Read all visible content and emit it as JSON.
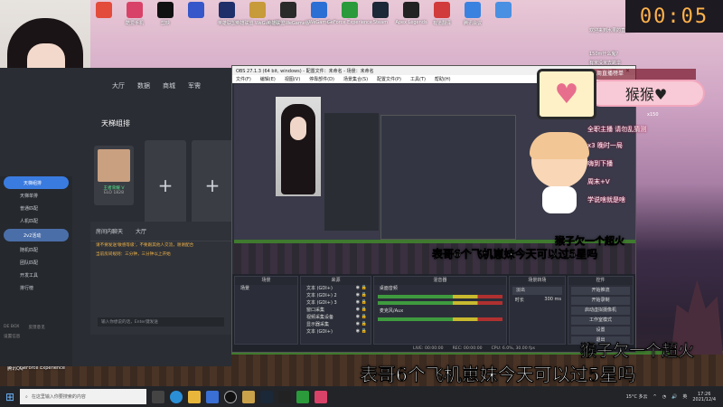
{
  "desktop_icons_top": [
    {
      "label": "",
      "color": "#e34b3b"
    },
    {
      "label": "酷爱手机",
      "color": "#d94268"
    },
    {
      "label": "剪映",
      "color": "#111111"
    },
    {
      "label": "",
      "color": "#3657c9"
    },
    {
      "label": "英雄联盟",
      "color": "#1e2f6a"
    },
    {
      "label": "英雄联盟 WeGame版",
      "color": "#c79a3a"
    },
    {
      "label": "英雄联盟WeGame版",
      "color": "#2a2a2a"
    },
    {
      "label": "WeGame",
      "color": "#2b6fd4"
    },
    {
      "label": "GeForce Experience",
      "color": "#2a9a3a"
    },
    {
      "label": "Steam",
      "color": "#1b2838"
    },
    {
      "label": "Apex Legends",
      "color": "#222222"
    },
    {
      "label": "有道翻译",
      "color": "#d13b3b"
    },
    {
      "label": "腾讯会议",
      "color": "#3a82e0"
    },
    {
      "label": "",
      "color": "#4a90e2"
    }
  ],
  "desktop_icons_bottom": [
    {
      "label": "腾讯QQ",
      "color": "#1a1a1a"
    },
    {
      "label": "GeForce Experience",
      "color": "#2a9a3a"
    }
  ],
  "timer": "00:05",
  "client": {
    "nav": [
      "大厅",
      "数据",
      "商城",
      "军需"
    ],
    "rank_title": "天梯组排",
    "rank_badge": "王者荣耀 V",
    "rank_sub": "ELO 1828",
    "sidebar": [
      "天梯组排",
      "天梯单排",
      "普通匹配",
      "人机匹配",
      "2v2活动",
      "随机匹配",
      "团队匹配",
      "开发工具",
      "排行榜"
    ],
    "sidebar_active_index": 0,
    "bottom_links": [
      "DE BOX",
      "反馈意见",
      "设置信息"
    ],
    "chat_tabs": [
      "房间内聊天",
      "大厅"
    ],
    "chat_lines": [
      "请不要发送'敏感等级'，不要跟其他人交流，谢谢配合",
      "当前房间规则：三分钟，三分钟以上开始"
    ],
    "chat_placeholder": "输入你想说的话，Enter键发送"
  },
  "obs": {
    "title": "OBS 27.1.3 (64 bit, windows) - 配置文件：未命名 - 场景：未命名",
    "menu": [
      "文件(F)",
      "编辑(E)",
      "视图(V)",
      "停靠部件(D)",
      "场景集合(S)",
      "配置文件(P)",
      "工具(T)",
      "帮助(H)"
    ],
    "dock_titles": [
      "场景",
      "来源",
      "混音器",
      "场景转场",
      "控件"
    ],
    "scenes": [
      "场景"
    ],
    "sources": [
      "文本 (GDI+)",
      "文本 (GDI+) 2",
      "文本 (GDI+) 3",
      "窗口采集",
      "视频采集设备",
      "显示器采集",
      "文本 (GDI+)"
    ],
    "mixer": [
      "桌面音频",
      "麦克风/Aux"
    ],
    "transition": "淡出",
    "duration_label": "时长",
    "duration": "300 ms",
    "controls": [
      "开始推流",
      "开始录制",
      "启动虚拟摄像机",
      "工作室模式",
      "设置",
      "退出"
    ],
    "status": [
      "LIVE: 00:00:00",
      "REC: 00:00:00",
      "CPU: 6.0%, 30.00 fps"
    ]
  },
  "overlay": {
    "speech_text": "猴猴♥",
    "pinned_text": "上周直播榜单",
    "rules": [
      "全职主播 请勿乱猜测",
      "x3 晚时一局",
      "嗨到下播",
      "周末+V",
      "学说啥就是啥"
    ],
    "chat_lines": [
      "欢迎来到水果的直播间",
      "150m什么鬼?",
      "有米没米去跳伞",
      "宝贝你好可爱",
      "欢迎进入直播间"
    ],
    "gift_label": "x150",
    "sub_line1": "猴子欠一个超火",
    "sub_line2": "表哥6个飞机崽妹今天可以过5星吗"
  },
  "taskbar": {
    "search_placeholder": "在这里输入你要搜索的内容",
    "weather": "15°C 多云",
    "time": "17:26",
    "date": "2021/12/4",
    "lang": "英"
  },
  "colors": {
    "accent": "#3a7be0",
    "obs_bg": "#2b2e38",
    "overlay_pink": "#f8c9d6",
    "timer": "#ffb34a"
  }
}
